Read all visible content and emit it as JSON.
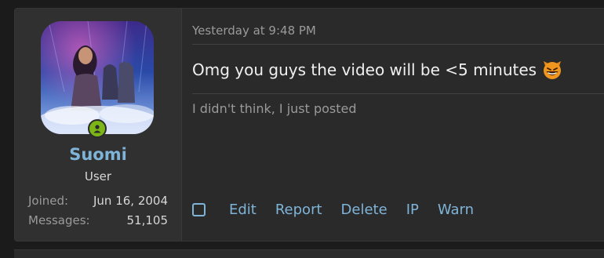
{
  "user": {
    "name": "Suomi",
    "title": "User",
    "joined_label": "Joined:",
    "joined_value": "Jun 16, 2004",
    "messages_label": "Messages:",
    "messages_value": "51,105",
    "online_status_icon": "user-online-icon",
    "online_color": "#7cb518"
  },
  "post": {
    "timestamp": "Yesterday at 9:48 PM",
    "message": "Omg you guys the video will be <5 minutes",
    "emoji": "grinning-devil-emoji",
    "signature": "I didn't think, I just posted"
  },
  "actions": {
    "edit": "Edit",
    "report": "Report",
    "delete": "Delete",
    "ip": "IP",
    "warn": "Warn"
  },
  "colors": {
    "link": "#7fb4d9",
    "background": "#2a2a2a",
    "username": "#7fb4d9"
  }
}
